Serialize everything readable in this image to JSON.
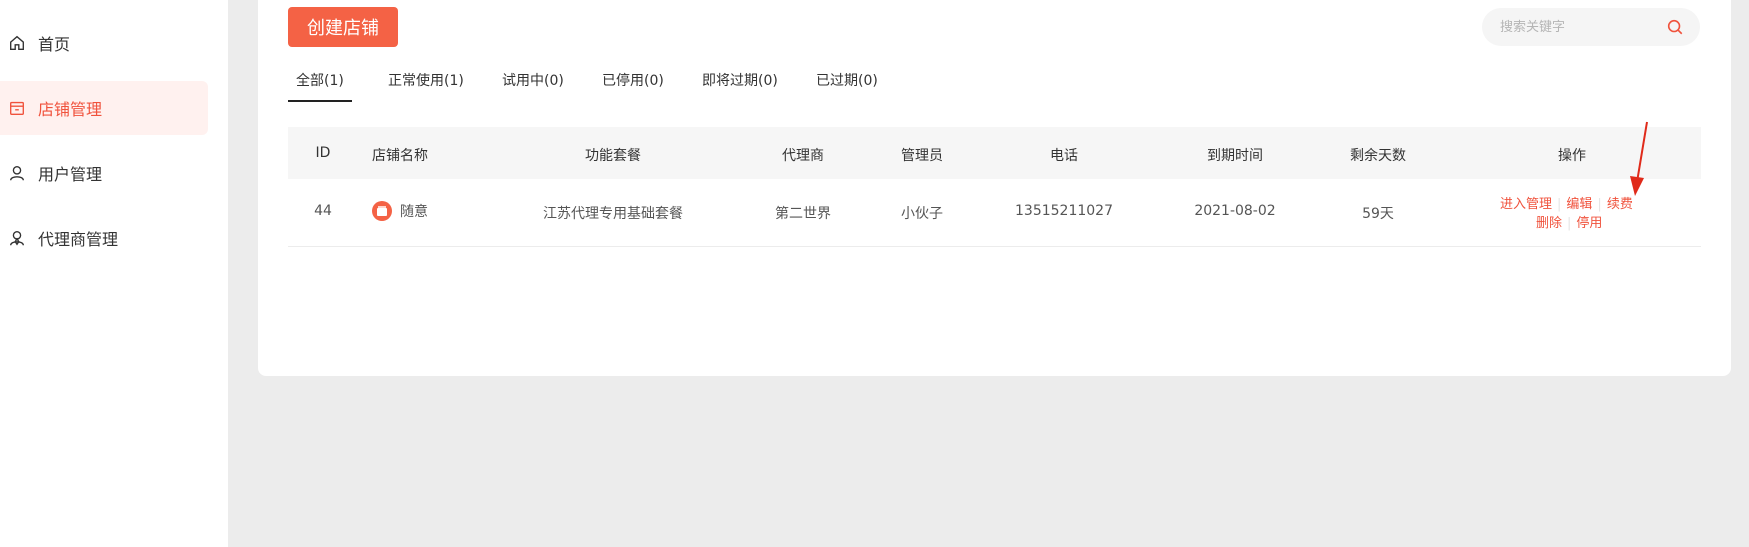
{
  "sidebar": {
    "items": [
      {
        "label": "首页",
        "icon": "home-icon",
        "active": false
      },
      {
        "label": "店铺管理",
        "icon": "store-icon",
        "active": true
      },
      {
        "label": "用户管理",
        "icon": "user-icon",
        "active": false
      },
      {
        "label": "代理商管理",
        "icon": "agent-icon",
        "active": false
      }
    ]
  },
  "toolbar": {
    "create_label": "创建店铺",
    "search_placeholder": "搜索关键字"
  },
  "tabs": [
    {
      "label": "全部(1)",
      "active": true
    },
    {
      "label": "正常使用(1)",
      "active": false
    },
    {
      "label": "试用中(0)",
      "active": false
    },
    {
      "label": "已停用(0)",
      "active": false
    },
    {
      "label": "即将过期(0)",
      "active": false
    },
    {
      "label": "已过期(0)",
      "active": false
    }
  ],
  "table": {
    "headers": [
      "ID",
      "店铺名称",
      "功能套餐",
      "代理商",
      "管理员",
      "电话",
      "到期时间",
      "剩余天数",
      "操作"
    ],
    "rows": [
      {
        "id": "44",
        "store_name": "随意",
        "package": "江苏代理专用基础套餐",
        "agent": "第二世界",
        "admin": "小伙子",
        "phone": "13515211027",
        "expire": "2021-08-02",
        "days_left": "59天",
        "actions": {
          "enter": "进入管理",
          "edit": "编辑",
          "renew": "续费",
          "delete": "删除",
          "disable": "停用"
        }
      }
    ]
  },
  "colors": {
    "accent": "#f46245",
    "active_text": "#f0523c",
    "active_bg": "#fff1ef"
  }
}
